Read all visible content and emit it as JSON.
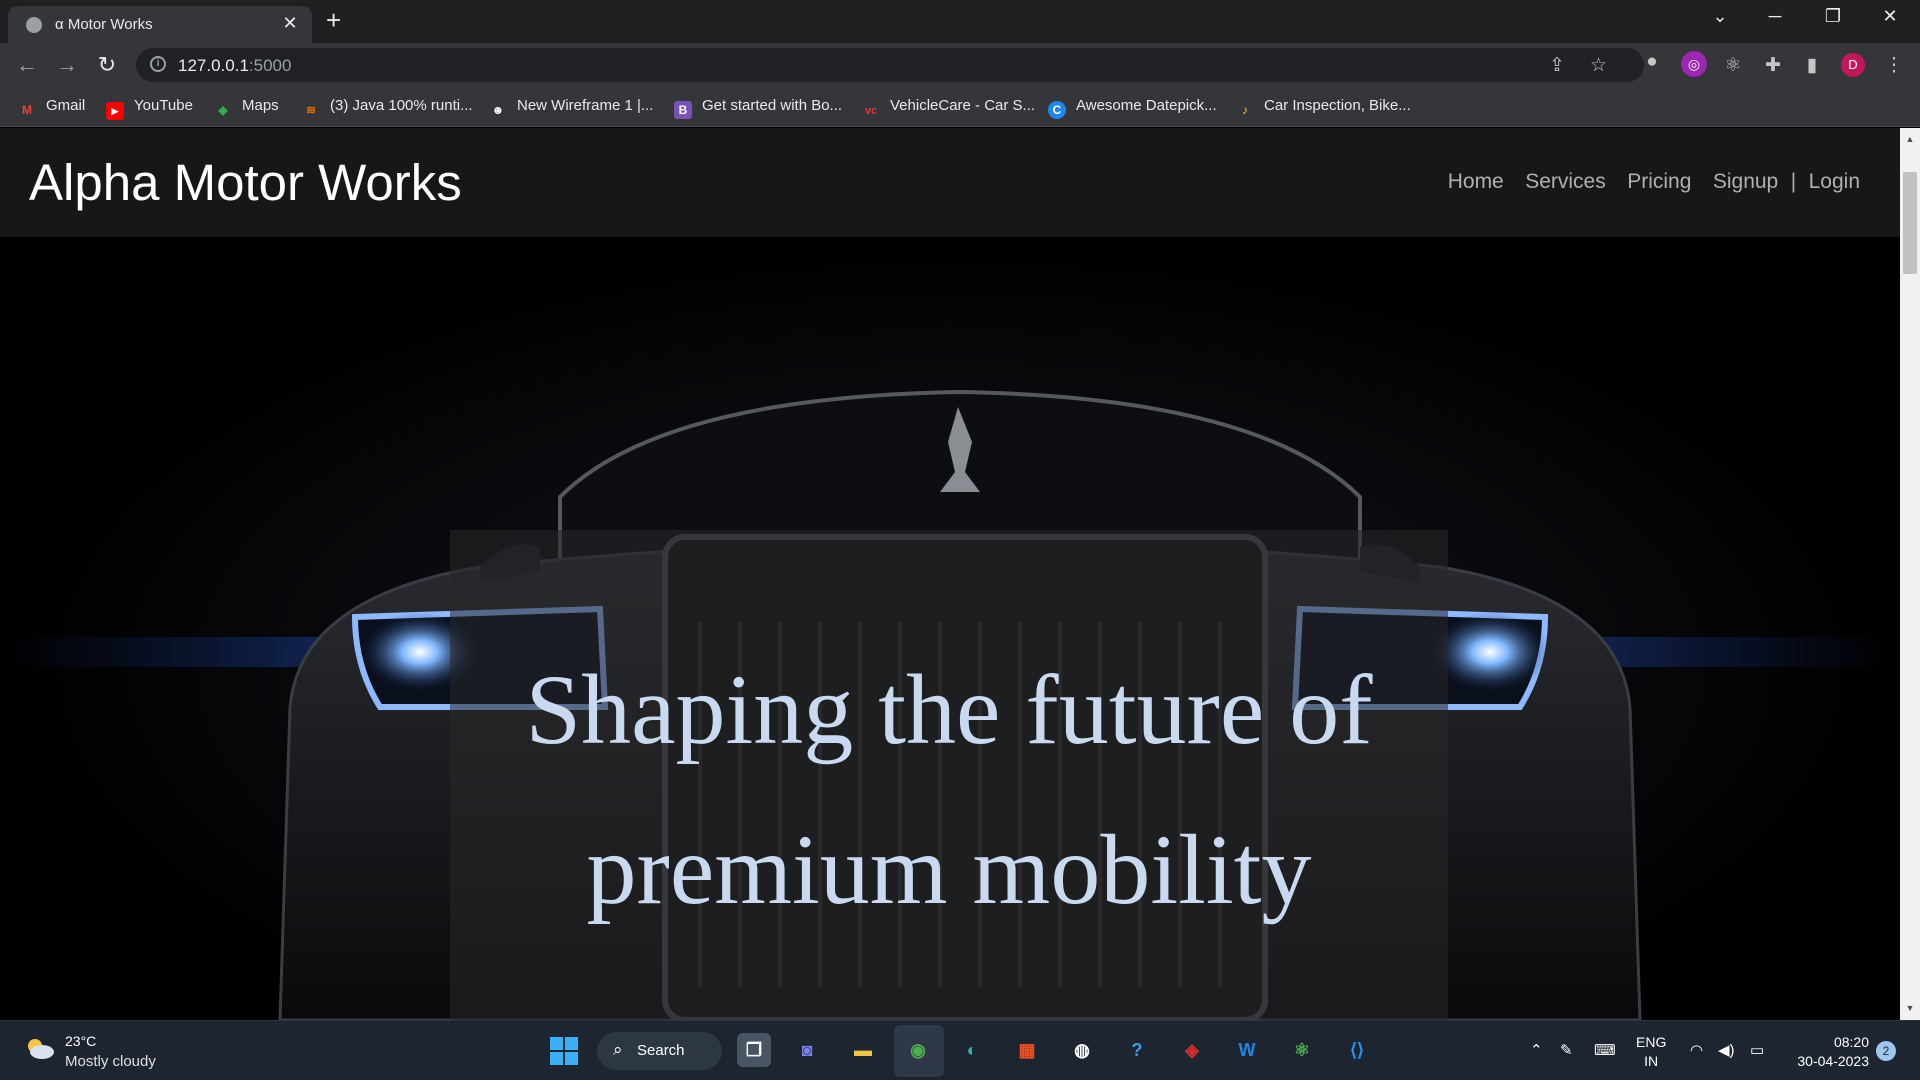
{
  "browser": {
    "tab_title": "α Motor Works",
    "url_host": "127.0.0.1",
    "url_port": ":5000",
    "bookmarks": [
      {
        "label": "Gmail",
        "icon": "gmail-icon",
        "color": "#ea4335",
        "glyph": "M"
      },
      {
        "label": "YouTube",
        "icon": "youtube-icon",
        "color": "#ff0000",
        "glyph": "▶"
      },
      {
        "label": "Maps",
        "icon": "maps-icon",
        "color": "#34a853",
        "glyph": "◆"
      },
      {
        "label": "(3) Java 100% runti...",
        "icon": "java-icon",
        "color": "#e76f00",
        "glyph": "≋"
      },
      {
        "label": "New Wireframe 1 |...",
        "icon": "wireframe-icon",
        "color": "#ffffff",
        "glyph": "☻"
      },
      {
        "label": "Get started with Bo...",
        "icon": "bootstrap-icon",
        "color": "#7952b3",
        "glyph": "B"
      },
      {
        "label": "VehicleCare - Car S...",
        "icon": "vehiclecare-icon",
        "color": "#e53935",
        "glyph": "vc"
      },
      {
        "label": "Awesome Datepick...",
        "icon": "datepicker-icon",
        "color": "#1e88e5",
        "glyph": "C"
      },
      {
        "label": "Car Inspection, Bike...",
        "icon": "inspection-icon",
        "color": "#fbc02d",
        "glyph": "♪"
      }
    ],
    "profile_initial": "D"
  },
  "site": {
    "brand": "Alpha Motor Works",
    "nav": {
      "home": "Home",
      "services": "Services",
      "pricing": "Pricing",
      "signup": "Signup",
      "separator": "|",
      "login": "Login"
    },
    "hero": {
      "line1": "Shaping the future of",
      "line2": "premium mobility"
    }
  },
  "taskbar": {
    "temperature": "23°C",
    "weather": "Mostly cloudy",
    "search_label": "Search",
    "lang_top": "ENG",
    "lang_bottom": "IN",
    "time": "08:20",
    "date": "30-04-2023",
    "notifications": "2"
  }
}
